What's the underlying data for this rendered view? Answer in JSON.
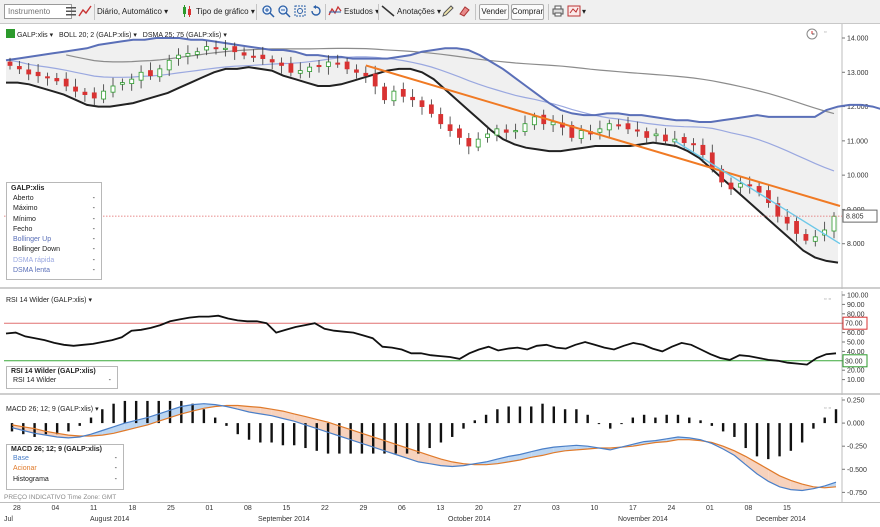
{
  "toolbar": {
    "instrument_placeholder": "Instrumento",
    "period": "Diário, Automático",
    "chart_type": "Tipo de gráfico",
    "studies": "Estudos",
    "annotations": "Anotações",
    "sell": "Vender",
    "buy": "Comprar"
  },
  "main_pane": {
    "title_symbol": "GALP:xlis",
    "title_boll": "BOLL 20; 2 (GALP:xlis)",
    "title_dsma": "DSMA 25; 75 (GALP:xlis)",
    "y_ticks": [
      "14.000",
      "13.000",
      "12.000",
      "11.000",
      "10.000",
      "9.000",
      "8.000"
    ],
    "last_price": "8.805",
    "legend": {
      "title": "GALP:xlis",
      "rows": [
        {
          "label": "Aberto",
          "value": "-",
          "color": "#222222"
        },
        {
          "label": "Máximo",
          "value": "-",
          "color": "#222222"
        },
        {
          "label": "Mínimo",
          "value": "-",
          "color": "#222222"
        },
        {
          "label": "Fecho",
          "value": "-",
          "color": "#222222"
        },
        {
          "label": "Bollinger Up",
          "value": "-",
          "color": "#5a6fb8"
        },
        {
          "label": "Bollinger Down",
          "value": "-",
          "color": "#222222"
        },
        {
          "label": "DSMA rápida",
          "value": "-",
          "color": "#9aa8e0"
        },
        {
          "label": "DSMA lenta",
          "value": "-",
          "color": "#5a6fb8"
        }
      ]
    }
  },
  "rsi_pane": {
    "title": "RSI 14 Wilder (GALP:xlis)",
    "y_ticks": [
      "100.00",
      "90.00",
      "80.00",
      "70.00",
      "60.00",
      "50.00",
      "40.00",
      "30.00",
      "20.00",
      "10.00"
    ],
    "upper_tag": "70.00",
    "lower_tag": "30.00",
    "legend": {
      "title": "RSI 14 Wilder (GALP:xlis)",
      "rows": [
        {
          "label": "RSI 14 Wilder",
          "value": "-",
          "color": "#222222"
        }
      ]
    }
  },
  "macd_pane": {
    "title": "MACD 26; 12; 9 (GALP:xlis)",
    "y_ticks": [
      "0.250",
      "0.000",
      "-0.250",
      "-0.500",
      "-0.750"
    ],
    "legend": {
      "title": "MACD 26; 12; 9 (GALP:xlis)",
      "rows": [
        {
          "label": "Base",
          "value": "-",
          "color": "#4a7fc8"
        },
        {
          "label": "Acionar",
          "value": "-",
          "color": "#e07a2a"
        },
        {
          "label": "Histograma",
          "value": "-",
          "color": "#222222"
        }
      ]
    }
  },
  "footer_note": "PREÇO INDICATIVO    Time Zone: GMT",
  "x_axis": {
    "ticks": [
      "28",
      "04",
      "11",
      "18",
      "25",
      "01",
      "08",
      "15",
      "22",
      "29",
      "06",
      "13",
      "20",
      "27",
      "03",
      "10",
      "17",
      "24",
      "01",
      "08",
      "15"
    ],
    "months": [
      "Jul",
      "August 2014",
      "September 2014",
      "October 2014",
      "November 2014",
      "December 2014"
    ]
  },
  "chart_data": {
    "type": "candlestick",
    "symbol": "GALP:xlis",
    "ylim": [
      7.0,
      14.5
    ],
    "close": [
      13.2,
      13.1,
      12.95,
      12.9,
      12.85,
      12.75,
      12.6,
      12.45,
      12.35,
      12.25,
      12.45,
      12.6,
      12.7,
      12.8,
      13.0,
      12.9,
      13.1,
      13.35,
      13.5,
      13.55,
      13.6,
      13.75,
      13.7,
      13.7,
      13.6,
      13.5,
      13.45,
      13.4,
      13.3,
      13.2,
      13.0,
      13.05,
      13.15,
      13.2,
      13.3,
      13.25,
      13.1,
      13.0,
      12.9,
      12.6,
      12.2,
      12.45,
      12.3,
      12.2,
      12.0,
      11.8,
      11.5,
      11.3,
      11.1,
      10.85,
      11.05,
      11.2,
      11.35,
      11.25,
      11.3,
      11.5,
      11.7,
      11.5,
      11.55,
      11.4,
      11.1,
      11.3,
      11.2,
      11.35,
      11.5,
      11.45,
      11.35,
      11.3,
      11.1,
      11.2,
      11.0,
      11.05,
      10.95,
      10.9,
      10.6,
      10.2,
      9.8,
      9.6,
      9.75,
      9.7,
      9.5,
      9.2,
      8.8,
      8.6,
      8.3,
      8.1,
      8.2,
      8.4,
      8.8
    ],
    "bollinger_up": [
      13.35,
      13.4,
      13.45,
      13.5,
      13.55,
      13.6,
      13.65,
      13.7,
      13.8,
      13.85,
      13.9,
      13.95,
      13.95,
      14.0,
      14.0,
      14.0,
      13.95,
      13.95,
      13.9,
      13.85,
      13.8,
      13.75,
      13.7,
      13.65,
      13.65,
      13.6,
      13.5,
      13.5,
      13.45,
      13.45,
      13.4,
      13.4,
      13.4,
      13.4,
      13.45,
      13.5,
      13.6,
      13.65,
      13.7,
      13.7,
      13.65,
      13.5,
      13.3,
      13.1,
      12.85,
      12.6,
      12.35,
      12.1,
      11.9,
      11.8,
      11.75,
      11.75,
      11.8,
      11.8,
      11.75,
      11.75,
      11.7,
      11.65,
      11.6,
      11.6,
      11.55,
      11.55,
      11.6,
      11.65,
      11.7,
      11.75,
      11.7,
      11.7,
      11.7,
      11.7,
      11.7,
      11.9,
      12.0,
      12.05,
      12.05,
      12.0,
      11.9,
      11.85,
      11.8,
      11.75,
      11.6,
      11.3
    ],
    "bollinger_down": [
      12.7,
      12.7,
      12.65,
      12.55,
      12.45,
      12.35,
      12.2,
      12.05,
      12.0,
      12.0,
      12.05,
      12.1,
      12.2,
      12.3,
      12.4,
      12.55,
      12.7,
      12.85,
      13.0,
      13.1,
      13.1,
      13.15,
      13.1,
      13.05,
      12.9,
      12.8,
      12.7,
      12.6,
      12.6,
      12.65,
      12.75,
      12.85,
      12.95,
      13.05,
      13.1,
      13.1,
      13.0,
      12.8,
      12.5,
      12.2,
      11.9,
      11.6,
      11.3,
      11.05,
      10.9,
      10.8,
      10.75,
      10.7,
      10.7,
      10.75,
      10.8,
      10.85,
      10.85,
      10.85,
      10.85,
      10.9,
      10.95,
      10.9,
      10.85,
      10.7,
      10.5,
      10.2,
      9.9,
      9.6,
      9.3,
      9.0,
      8.7,
      8.4,
      8.1,
      7.8,
      7.6,
      7.5,
      7.45
    ]
  },
  "rsi_data": {
    "values": [
      59,
      60,
      56,
      54,
      52,
      49,
      47,
      46,
      47,
      48,
      50,
      52,
      55,
      62,
      63,
      65,
      68,
      72,
      74,
      76,
      77,
      77,
      78,
      75,
      73,
      72,
      72,
      70,
      60,
      63,
      66,
      68,
      70,
      64,
      62,
      61,
      60,
      57,
      54,
      45,
      44,
      42,
      38,
      38,
      36,
      35,
      34,
      32,
      38,
      42,
      45,
      41,
      43,
      44,
      42,
      46,
      47,
      44,
      43,
      47,
      50,
      47,
      44,
      42,
      46,
      49,
      47,
      43,
      40,
      45,
      49,
      47,
      42,
      37,
      33,
      31,
      36,
      35,
      33,
      31,
      30,
      28,
      27,
      26,
      33,
      37,
      38
    ]
  },
  "macd_data": {
    "base": [
      -0.05,
      -0.08,
      -0.11,
      -0.13,
      -0.15,
      -0.16,
      -0.15,
      -0.12,
      -0.08,
      -0.04,
      0.0,
      0.03,
      0.06,
      0.1,
      0.14,
      0.18,
      0.2,
      0.21,
      0.2,
      0.18,
      0.15,
      0.12,
      0.1,
      0.08,
      0.05,
      0.02,
      -0.02,
      -0.06,
      -0.1,
      -0.14,
      -0.18,
      -0.22,
      -0.26,
      -0.3,
      -0.34,
      -0.38,
      -0.42,
      -0.44,
      -0.46,
      -0.47,
      -0.46,
      -0.44,
      -0.42,
      -0.39,
      -0.36,
      -0.34,
      -0.31,
      -0.28,
      -0.26,
      -0.25,
      -0.24,
      -0.25,
      -0.27,
      -0.29,
      -0.26,
      -0.23,
      -0.2,
      -0.19,
      -0.17,
      -0.15,
      -0.16,
      -0.18,
      -0.22,
      -0.28,
      -0.35,
      -0.45,
      -0.55,
      -0.63,
      -0.69,
      -0.72,
      -0.73,
      -0.71,
      -0.68,
      -0.64
    ],
    "trigger": [
      -0.02,
      -0.04,
      -0.06,
      -0.09,
      -0.11,
      -0.13,
      -0.14,
      -0.14,
      -0.13,
      -0.11,
      -0.08,
      -0.05,
      -0.02,
      0.02,
      0.06,
      0.1,
      0.13,
      0.16,
      0.18,
      0.19,
      0.19,
      0.18,
      0.17,
      0.15,
      0.13,
      0.1,
      0.07,
      0.04,
      0.01,
      -0.03,
      -0.07,
      -0.11,
      -0.15,
      -0.19,
      -0.23,
      -0.27,
      -0.31,
      -0.35,
      -0.39,
      -0.42,
      -0.44,
      -0.45,
      -0.45,
      -0.44,
      -0.42,
      -0.4,
      -0.37,
      -0.35,
      -0.32,
      -0.3,
      -0.29,
      -0.28,
      -0.27,
      -0.27,
      -0.26,
      -0.25,
      -0.23,
      -0.21,
      -0.2,
      -0.18,
      -0.18,
      -0.19,
      -0.21,
      -0.25,
      -0.3,
      -0.36,
      -0.43,
      -0.5,
      -0.57,
      -0.62,
      -0.66,
      -0.69,
      -0.7,
      -0.69
    ]
  },
  "colors": {
    "bull": "#2c9a2c",
    "bear": "#d83232",
    "bollinger_up": "#5a6fb8",
    "bollinger_down": "#222222",
    "dsma_fast": "#9aa8e0",
    "dsma_slow": "#8c8c8c",
    "trendline": "#f07a24",
    "trendline2": "#6cc8e8",
    "macd_base": "#4a7fc8",
    "macd_trigger": "#e07a2a"
  }
}
